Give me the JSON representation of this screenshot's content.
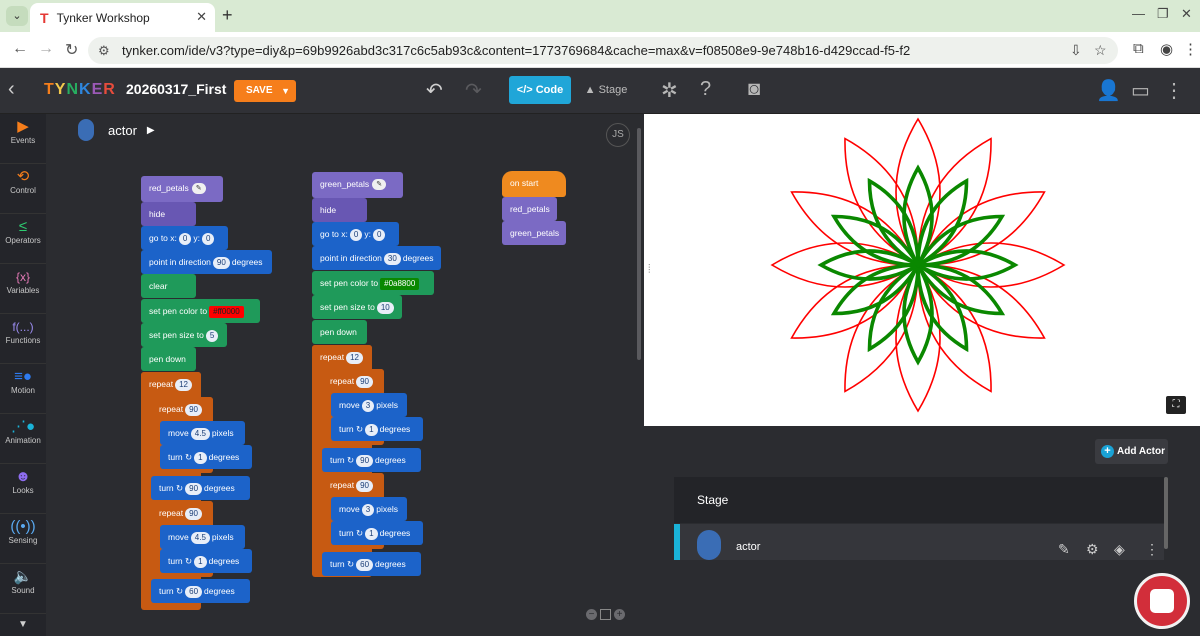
{
  "browser": {
    "tab_title": "Tynker Workshop",
    "tab_close": "✕",
    "new_tab": "+",
    "url": "tynker.com/ide/v3?type=diy&p=69b9926abd3c317c6c5ab93c&content=1773769684&cache=max&v=f08508e9-9e748b16-d429ccad-f5-f2"
  },
  "app": {
    "logo": "TYNKER",
    "project_name": "20260317_First",
    "save_label": "SAVE",
    "code_label": "Code",
    "stage_label": "Stage"
  },
  "sidebar": {
    "items": [
      {
        "label": "Events",
        "icon": "play-icon",
        "color": "#f67e1b"
      },
      {
        "label": "Control",
        "icon": "loop-icon",
        "color": "#f67e1b"
      },
      {
        "label": "Operators",
        "icon": "lessthan-icon",
        "color": "#2ecc71"
      },
      {
        "label": "Variables",
        "icon": "variable-icon",
        "color": "#e57ab7"
      },
      {
        "label": "Functions",
        "icon": "function-icon",
        "color": "#9b8cf0"
      },
      {
        "label": "Motion",
        "icon": "motion-icon",
        "color": "#2e7bf0"
      },
      {
        "label": "Animation",
        "icon": "animation-icon",
        "color": "#1ab3d8"
      },
      {
        "label": "Looks",
        "icon": "looks-icon",
        "color": "#8e6cf0"
      },
      {
        "label": "Sensing",
        "icon": "sensing-icon",
        "color": "#5aa9f0"
      },
      {
        "label": "Sound",
        "icon": "sound-icon",
        "color": "#e24fc8"
      }
    ]
  },
  "workspace": {
    "actor_name": "actor",
    "js_label": "JS",
    "red_script": {
      "header": "red_petals",
      "hide": "hide",
      "goto": "go to x:",
      "goto_y": "y:",
      "x": "0",
      "y": "0",
      "point": "point in direction",
      "point_val": "90",
      "degrees": "degrees",
      "clear": "clear",
      "pen_color": "set pen color to",
      "pen_color_val": "#ff0000",
      "pen_size": "set pen size to",
      "pen_size_val": "5",
      "pen_down": "pen down",
      "repeat": "repeat",
      "repeat_outer": "12",
      "repeat_inner1": "90",
      "move": "move",
      "move_val": "4.5",
      "pixels": "pixels",
      "turn": "turn ↻",
      "turn_small": "1",
      "turn_mid": "90",
      "repeat_inner2": "90",
      "turn_end": "60"
    },
    "green_script": {
      "header": "green_petals",
      "hide": "hide",
      "goto": "go to x:",
      "goto_y": "y:",
      "x": "0",
      "y": "0",
      "point": "point in direction",
      "point_val": "30",
      "degrees": "degrees",
      "pen_color": "set pen color to",
      "pen_color_val": "#0a8800",
      "pen_size": "set pen size to",
      "pen_size_val": "10",
      "pen_down": "pen down",
      "repeat": "repeat",
      "repeat_outer": "12",
      "repeat_inner1": "90",
      "move": "move",
      "move_val": "3",
      "pixels": "pixels",
      "turn": "turn ↻",
      "turn_small": "1",
      "turn_mid": "90",
      "repeat_inner2": "90",
      "turn_end": "60"
    },
    "start_script": {
      "event": "on start",
      "call1": "red_petals",
      "call2": "green_petals"
    }
  },
  "stage_panel": {
    "add_actor": "Add Actor",
    "stage_label": "Stage",
    "actor_label": "actor"
  },
  "colors": {
    "red_pen": "#ff0000",
    "green_pen": "#0a8800",
    "accent": "#20a6d8",
    "save": "#f67e1b"
  }
}
